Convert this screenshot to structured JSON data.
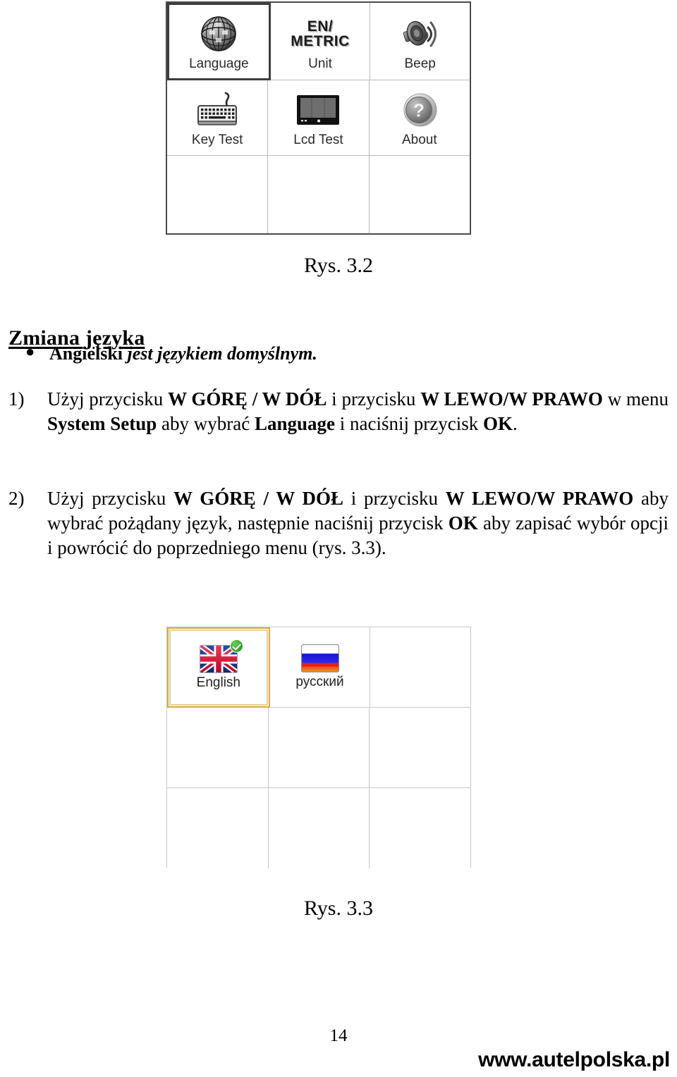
{
  "figures": {
    "system_setup": {
      "caption": "Rys. 3.2",
      "selected_item": "Language",
      "items": [
        {
          "label": "Language",
          "icon": "globe-icon",
          "selected": true
        },
        {
          "label": "Unit",
          "icon": "en-metric-text-icon",
          "icon_text_line1": "EN/",
          "icon_text_line2": "METRIC",
          "selected": false
        },
        {
          "label": "Beep",
          "icon": "speaker-icon",
          "selected": false
        },
        {
          "label": "Key Test",
          "icon": "keyboard-icon",
          "selected": false
        },
        {
          "label": "Lcd Test",
          "icon": "monitor-icon",
          "selected": false
        },
        {
          "label": "About",
          "icon": "question-mark-icon",
          "selected": false
        }
      ]
    },
    "language_select": {
      "caption": "Rys. 3.3",
      "selected_item": "English",
      "items": [
        {
          "label": "English",
          "icon": "union-jack-flag-icon",
          "selected": true,
          "checked": true
        },
        {
          "label": "русский",
          "icon": "russian-flag-icon",
          "selected": false,
          "checked": false
        }
      ]
    }
  },
  "content": {
    "heading": "Zmiana języka",
    "bullet": {
      "bold_part": "Angielski ",
      "italic_part": "jest językiem domyślnym."
    },
    "steps": [
      {
        "number": "1)",
        "seg": [
          {
            "t": "Użyj przycisku ",
            "b": false
          },
          {
            "t": "W GÓRĘ / W DÓŁ",
            "b": true
          },
          {
            "t": " i przycisku ",
            "b": false
          },
          {
            "t": "W LEWO/W PRAWO",
            "b": true
          },
          {
            "t": " w menu ",
            "b": false
          },
          {
            "t": "System Setup",
            "b": true
          },
          {
            "t": " aby wybrać ",
            "b": false
          },
          {
            "t": "Language",
            "b": true
          },
          {
            "t": " i naciśnij przycisk ",
            "b": false
          },
          {
            "t": "OK",
            "b": true
          },
          {
            "t": ".",
            "b": false
          }
        ]
      },
      {
        "number": "2)",
        "seg": [
          {
            "t": "Użyj przycisku ",
            "b": false
          },
          {
            "t": "W GÓRĘ / W DÓŁ",
            "b": true
          },
          {
            "t": " i przycisku ",
            "b": false
          },
          {
            "t": "W LEWO/W PRAWO",
            "b": true
          },
          {
            "t": " aby wybrać pożądany język, następnie naciśnij przycisk ",
            "b": false
          },
          {
            "t": "OK",
            "b": true
          },
          {
            "t": " aby zapisać wybór opcji i powrócić do poprzedniego menu (rys. 3.3).",
            "b": false
          }
        ]
      }
    ]
  },
  "footer": {
    "page_number": "14",
    "url": "www.autelpolska.pl"
  },
  "colors": {
    "selected_border_setup": "#3d3d3d",
    "selected_border_language": "#d7ab45",
    "check_badge_green": "#2f9e28",
    "grid_line": "#c8c8c8"
  }
}
